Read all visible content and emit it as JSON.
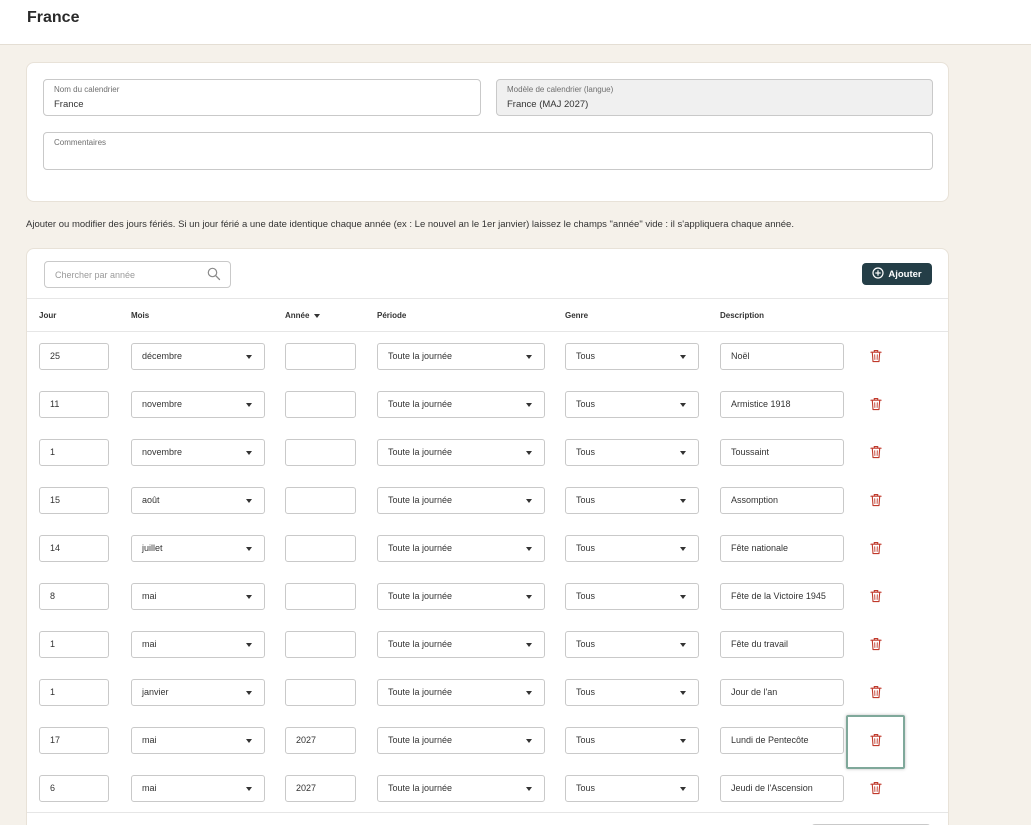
{
  "page": {
    "title": "France"
  },
  "calendar": {
    "name_label": "Nom du calendrier",
    "name_value": "France",
    "template_label": "Modèle de calendrier (langue)",
    "template_value": "France (MAJ 2027)",
    "comments_label": "Commentaires",
    "comments_value": ""
  },
  "help_text": "Ajouter ou modifier des jours fériés. Si un jour férié a une date identique chaque année (ex : Le nouvel an le 1er janvier) laissez le champs \"année\" vide : il s'appliquera chaque année.",
  "search": {
    "placeholder": "Chercher par année"
  },
  "add_button": {
    "label": "Ajouter"
  },
  "columns": {
    "jour": "Jour",
    "mois": "Mois",
    "annee": "Année",
    "periode": "Période",
    "genre": "Genre",
    "description": "Description"
  },
  "rows": [
    {
      "jour": "25",
      "mois": "décembre",
      "annee": "",
      "periode": "Toute la journée",
      "genre": "Tous",
      "description": "Noël"
    },
    {
      "jour": "11",
      "mois": "novembre",
      "annee": "",
      "periode": "Toute la journée",
      "genre": "Tous",
      "description": "Armistice 1918"
    },
    {
      "jour": "1",
      "mois": "novembre",
      "annee": "",
      "periode": "Toute la journée",
      "genre": "Tous",
      "description": "Toussaint"
    },
    {
      "jour": "15",
      "mois": "août",
      "annee": "",
      "periode": "Toute la journée",
      "genre": "Tous",
      "description": "Assomption"
    },
    {
      "jour": "14",
      "mois": "juillet",
      "annee": "",
      "periode": "Toute la journée",
      "genre": "Tous",
      "description": "Fête nationale"
    },
    {
      "jour": "8",
      "mois": "mai",
      "annee": "",
      "periode": "Toute la journée",
      "genre": "Tous",
      "description": "Fête de la Victoire 1945"
    },
    {
      "jour": "1",
      "mois": "mai",
      "annee": "",
      "periode": "Toute la journée",
      "genre": "Tous",
      "description": "Fête du travail"
    },
    {
      "jour": "1",
      "mois": "janvier",
      "annee": "",
      "periode": "Toute la journée",
      "genre": "Tous",
      "description": "Jour de l'an"
    },
    {
      "jour": "17",
      "mois": "mai",
      "annee": "2027",
      "periode": "Toute la journée",
      "genre": "Tous",
      "description": "Lundi de Pentecôte"
    },
    {
      "jour": "6",
      "mois": "mai",
      "annee": "2027",
      "periode": "Toute la journée",
      "genre": "Tous",
      "description": "Jeudi de l'Ascension"
    }
  ],
  "colors": {
    "accent": "#243e47",
    "delete": "#c0392b",
    "background": "#f5f1ea",
    "focus": "#7fa89a"
  },
  "icons": {
    "search": "search-icon",
    "add": "plus-circle-icon",
    "delete": "trash-icon"
  }
}
